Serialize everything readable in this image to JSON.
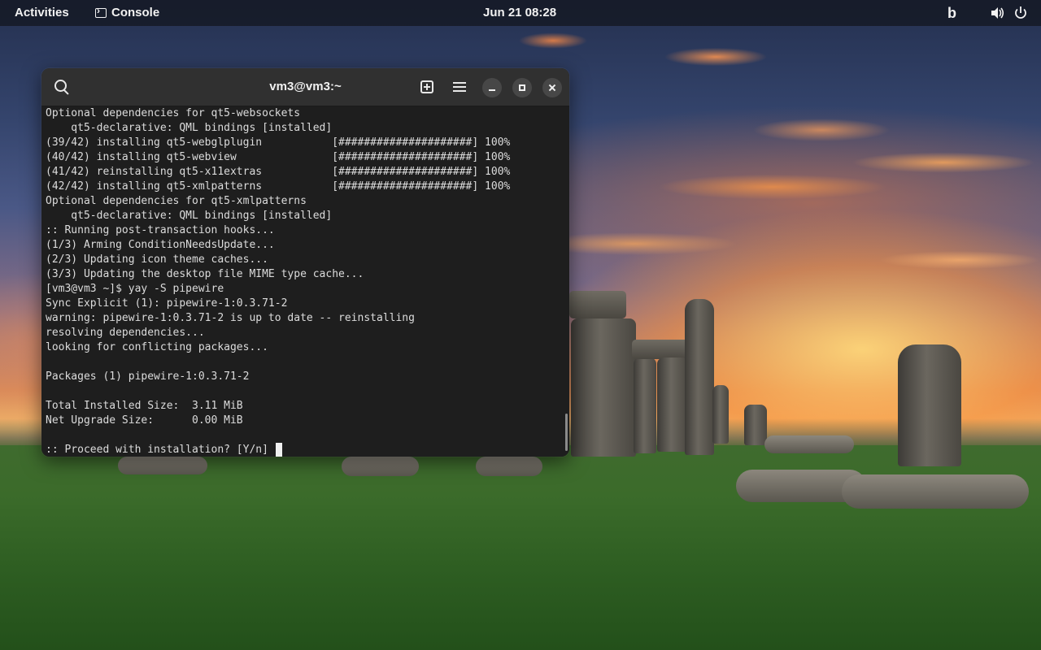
{
  "topbar": {
    "activities": "Activities",
    "app_name": "Console",
    "clock": "Jun 21  08:28",
    "tray_icon_b": "b",
    "volume_icon": "volume-icon",
    "power_icon": "power-icon"
  },
  "window": {
    "title": "vm3@vm3:~",
    "icons": [
      "search-icon",
      "new-tab-icon",
      "menu-icon",
      "minimize-icon",
      "maximize-icon",
      "close-icon"
    ]
  },
  "terminal": {
    "lines": [
      "Optional dependencies for qt5-websockets",
      "    qt5-declarative: QML bindings [installed]",
      "(39/42) installing qt5-webglplugin           [#####################] 100%",
      "(40/42) installing qt5-webview               [#####################] 100%",
      "(41/42) reinstalling qt5-x11extras           [#####################] 100%",
      "(42/42) installing qt5-xmlpatterns           [#####################] 100%",
      "Optional dependencies for qt5-xmlpatterns",
      "    qt5-declarative: QML bindings [installed]",
      ":: Running post-transaction hooks...",
      "(1/3) Arming ConditionNeedsUpdate...",
      "(2/3) Updating icon theme caches...",
      "(3/3) Updating the desktop file MIME type cache...",
      "[vm3@vm3 ~]$ yay -S pipewire",
      "Sync Explicit (1): pipewire-1:0.3.71-2",
      "warning: pipewire-1:0.3.71-2 is up to date -- reinstalling",
      "resolving dependencies...",
      "looking for conflicting packages...",
      "",
      "Packages (1) pipewire-1:0.3.71-2",
      "",
      "Total Installed Size:  3.11 MiB",
      "Net Upgrade Size:      0.00 MiB",
      ""
    ],
    "prompt": ":: Proceed with installation? [Y/n] "
  }
}
